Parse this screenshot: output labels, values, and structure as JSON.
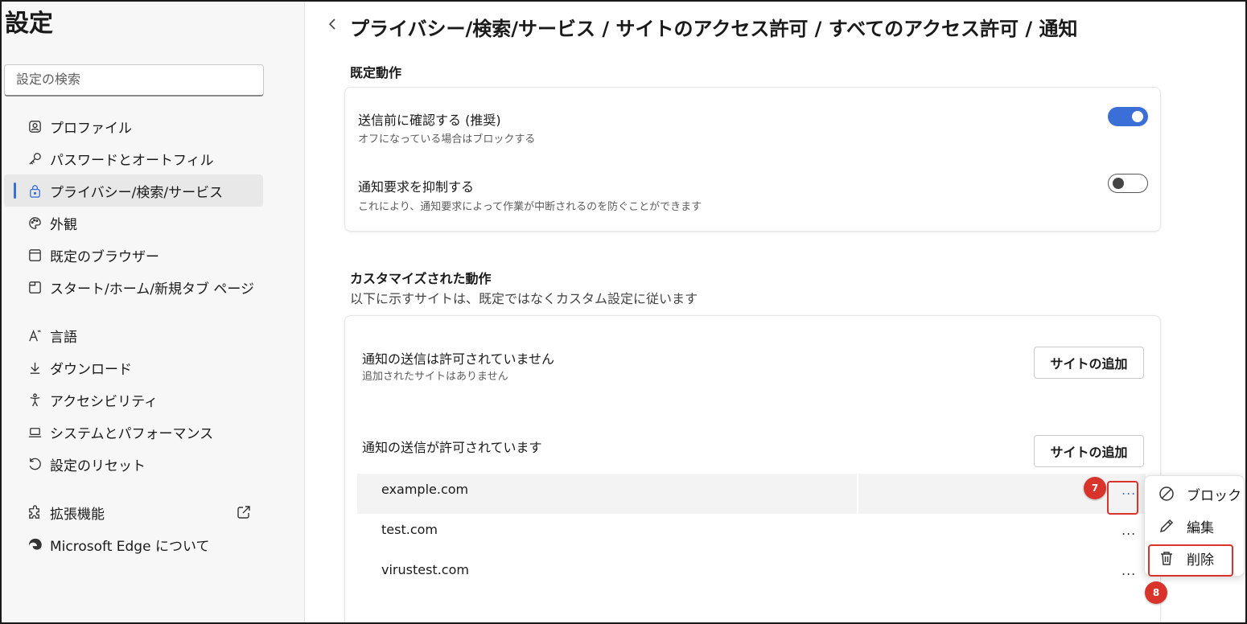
{
  "app": {
    "title": "設定"
  },
  "search": {
    "placeholder": "設定の検索"
  },
  "sidebar": {
    "items": [
      {
        "label": "プロファイル",
        "icon": "profile-icon"
      },
      {
        "label": "パスワードとオートフィル",
        "icon": "key-icon"
      },
      {
        "label": "プライバシー/検索/サービス",
        "icon": "lock-icon",
        "active": true
      },
      {
        "label": "外観",
        "icon": "palette-icon"
      },
      {
        "label": "既定のブラウザー",
        "icon": "browser-window-icon"
      },
      {
        "label": "スタート/ホーム/新規タブ ページ",
        "icon": "new-tab-icon"
      },
      {
        "label": "言語",
        "icon": "language-icon"
      },
      {
        "label": "ダウンロード",
        "icon": "download-icon"
      },
      {
        "label": "アクセシビリティ",
        "icon": "accessibility-icon"
      },
      {
        "label": "システムとパフォーマンス",
        "icon": "laptop-icon"
      },
      {
        "label": "設定のリセット",
        "icon": "reset-icon"
      },
      {
        "label": "拡張機能",
        "icon": "puzzle-icon"
      },
      {
        "label": "Microsoft Edge について",
        "icon": "edge-logo-icon"
      }
    ]
  },
  "header": {
    "breadcrumb": "プライバシー/検索/サービス / サイトのアクセス許可 / すべてのアクセス許可 / 通知"
  },
  "default_behavior": {
    "heading": "既定動作",
    "rows": [
      {
        "title": "送信前に確認する (推奨)",
        "desc": "オフになっている場合はブロックする",
        "enabled": true
      },
      {
        "title": "通知要求を抑制する",
        "desc": "これにより、通知要求によって作業が中断されるのを防ぐことができます",
        "enabled": false
      }
    ]
  },
  "custom_behavior": {
    "heading": "カスタマイズされた動作",
    "subheading": "以下に示すサイトは、既定ではなくカスタム設定に従います",
    "blocked": {
      "title": "通知の送信は許可されていません",
      "desc": "追加されたサイトはありません",
      "add_label": "サイトの追加"
    },
    "allowed": {
      "title": "通知の送信が許可されています",
      "add_label": "サイトの追加",
      "sites": [
        "example.com",
        "test.com",
        "virustest.com"
      ],
      "more_label": "..."
    }
  },
  "context_menu": {
    "items": [
      {
        "label": "ブロック",
        "icon": "block-icon"
      },
      {
        "label": "編集",
        "icon": "pencil-icon"
      },
      {
        "label": "削除",
        "icon": "trash-icon"
      }
    ]
  },
  "annotations": {
    "step7": "7",
    "step8": "8"
  },
  "colors": {
    "accent": "#3a6fd8",
    "callout": "#d9342b"
  }
}
